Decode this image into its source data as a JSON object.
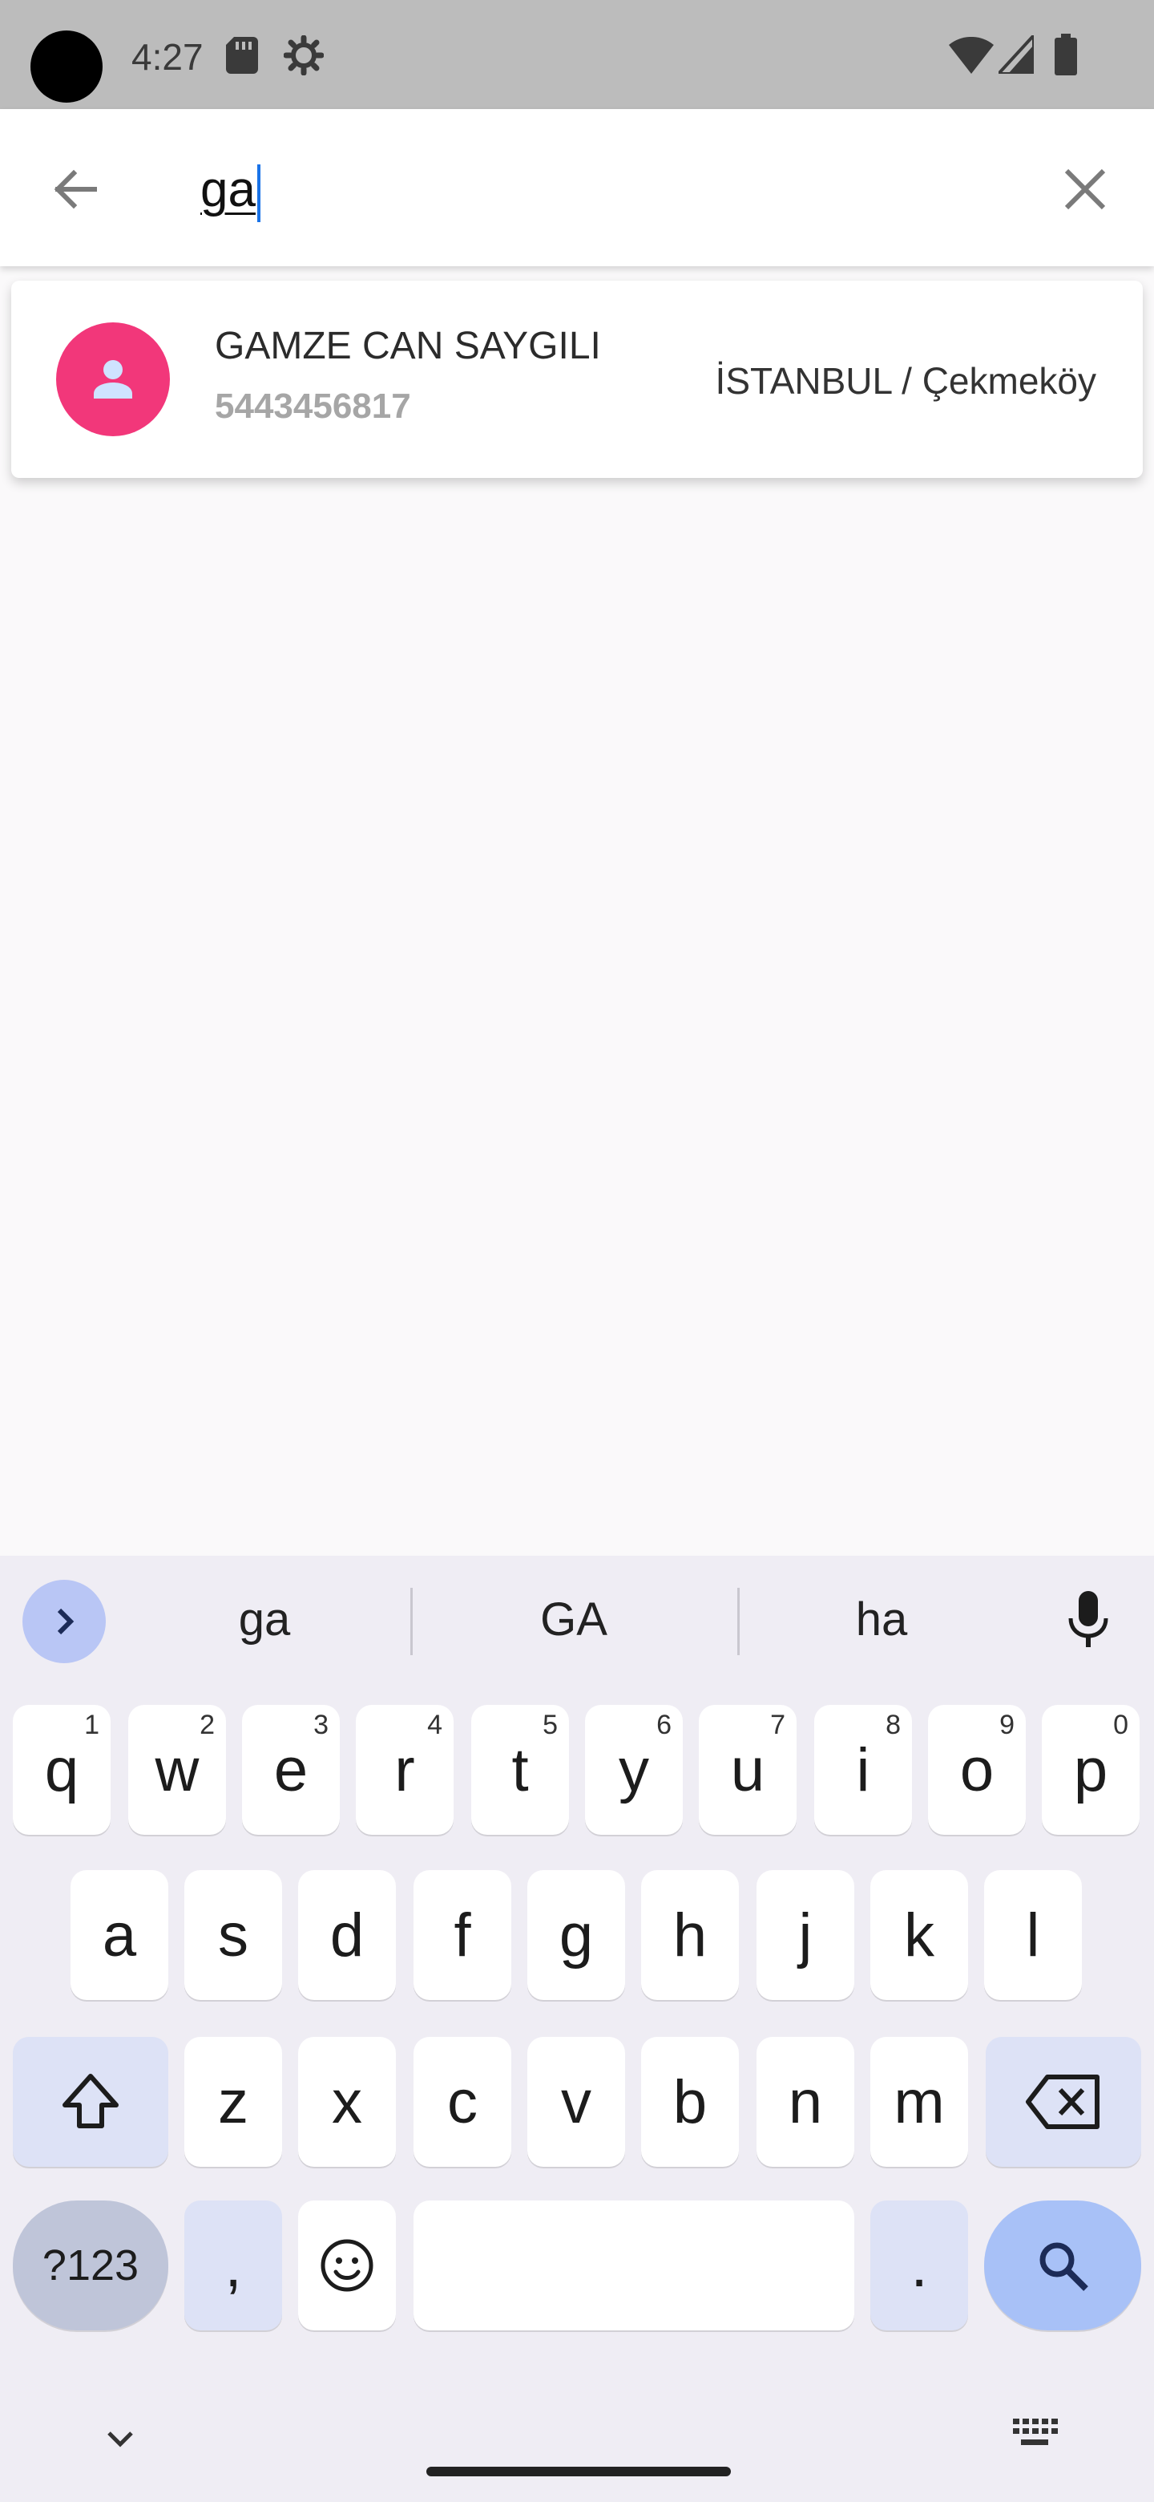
{
  "status_bar": {
    "time": "4:27",
    "icons": [
      "sd-card-icon",
      "gear-icon",
      "wifi-icon",
      "signal-icon",
      "battery-icon"
    ]
  },
  "search": {
    "query": "ga",
    "back_icon": "arrow-back-icon",
    "clear_icon": "close-icon"
  },
  "results": [
    {
      "name": "GAMZE CAN SAYGILI",
      "phone": "5443456817",
      "location": "İSTANBUL / Çekmeköy",
      "avatar_color": "#f2377a",
      "avatar_icon": "person-icon"
    }
  ],
  "keyboard": {
    "suggestions": [
      "ga",
      "GA",
      "ha"
    ],
    "row1": [
      {
        "key": "q",
        "hint": "1"
      },
      {
        "key": "w",
        "hint": "2"
      },
      {
        "key": "e",
        "hint": "3"
      },
      {
        "key": "r",
        "hint": "4"
      },
      {
        "key": "t",
        "hint": "5"
      },
      {
        "key": "y",
        "hint": "6"
      },
      {
        "key": "u",
        "hint": "7"
      },
      {
        "key": "i",
        "hint": "8"
      },
      {
        "key": "o",
        "hint": "9"
      },
      {
        "key": "p",
        "hint": "0"
      }
    ],
    "row2": [
      "a",
      "s",
      "d",
      "f",
      "g",
      "h",
      "j",
      "k",
      "l"
    ],
    "row3": [
      "z",
      "x",
      "c",
      "v",
      "b",
      "n",
      "m"
    ],
    "symbols_label": "?123",
    "comma_label": ",",
    "period_label": "."
  },
  "colors": {
    "accent": "#1a73e8",
    "avatar": "#f2377a",
    "keyboard_bg": "#efedf4",
    "action_key": "#a8c1f7"
  }
}
